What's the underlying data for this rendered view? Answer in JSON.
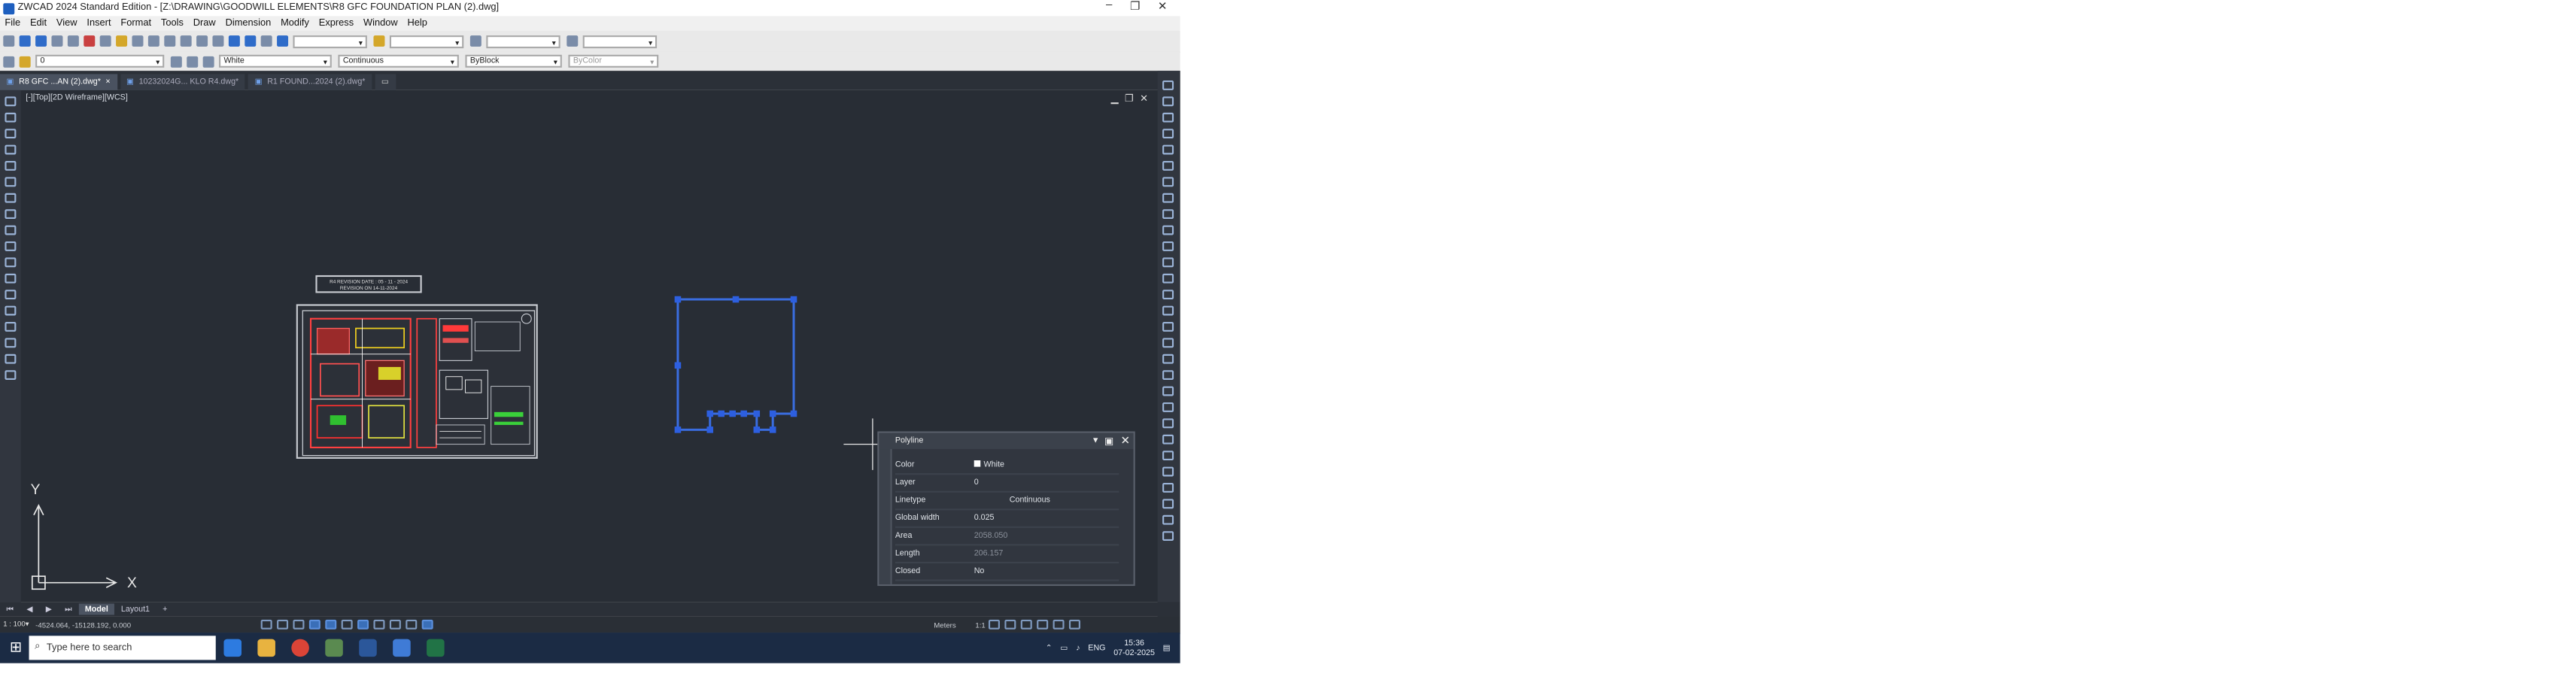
{
  "window": {
    "title": "ZWCAD 2024 Standard Edition - [Z:\\DRAWING\\GOODWILL ELEMENTS\\R8  GFC FOUNDATION PLAN (2).dwg]",
    "minimize": "–",
    "maximize": "❐",
    "close": "✕"
  },
  "menu": [
    "File",
    "Edit",
    "View",
    "Insert",
    "Format",
    "Tools",
    "Draw",
    "Dimension",
    "Modify",
    "Express",
    "Window",
    "Help"
  ],
  "toolbar2": {
    "layer_value": "0",
    "color_value": "White",
    "linetype_value": "Continuous",
    "lineweight_value": "ByBlock",
    "plotstyle_value": "ByColor"
  },
  "doc_tabs": [
    {
      "label": "R8  GFC ...AN (2).dwg*",
      "active": true
    },
    {
      "label": "10232024G... KLO R4.dwg*",
      "active": false
    },
    {
      "label": "R1  FOUND...2024 (2).dwg*",
      "active": false
    }
  ],
  "viewport": {
    "label": "[-][Top][2D Wireframe][WCS]",
    "ucs_x": "X",
    "ucs_y": "Y"
  },
  "drawing": {
    "revision_line1": "R4 REVISION DATE : 05 - 11 - 2024",
    "revision_line2": "REVISION ON 14-11-2024"
  },
  "properties": {
    "title": "Polyline",
    "rows": [
      {
        "key": "Color",
        "value": "White",
        "dim": false
      },
      {
        "key": "Layer",
        "value": "0",
        "dim": false
      },
      {
        "key": "Linetype",
        "value": "Continuous",
        "dim": false
      },
      {
        "key": "Global width",
        "value": "0.025",
        "dim": false
      },
      {
        "key": "Area",
        "value": "2058.050",
        "dim": true
      },
      {
        "key": "Length",
        "value": "206.157",
        "dim": true
      },
      {
        "key": "Closed",
        "value": "No",
        "dim": false
      }
    ]
  },
  "layout_tabs": {
    "model": "Model",
    "layout1": "Layout1",
    "add": "+"
  },
  "status": {
    "scale": "1 : 100▾",
    "coords": "-4524.064, -15128.192, 0.000",
    "units": "Meters",
    "annotation_scale": "1:1"
  },
  "taskbar": {
    "search_placeholder": "Type here to search",
    "language": "ENG",
    "time": "15:36",
    "date": "07-02-2025"
  }
}
